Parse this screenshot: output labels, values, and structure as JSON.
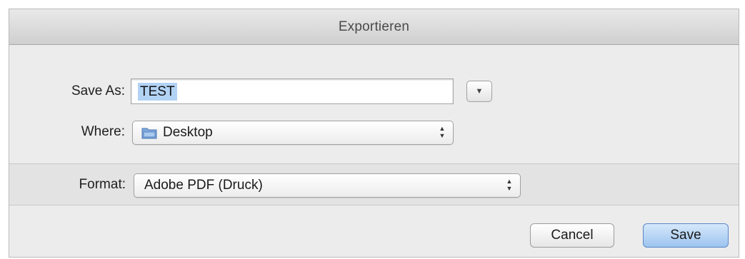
{
  "window": {
    "title": "Exportieren"
  },
  "save_as": {
    "label": "Save As:",
    "value": "TEST",
    "disclosure_icon": "triangle-down-icon"
  },
  "where": {
    "label": "Where:",
    "value": "Desktop",
    "icon": "folder-icon"
  },
  "format": {
    "label": "Format:",
    "value": "Adobe PDF (Druck)"
  },
  "buttons": {
    "cancel": "Cancel",
    "save": "Save"
  },
  "colors": {
    "selection": "#b3d3f5",
    "default_button": "#9cc4ef",
    "folder_icon": "#5d8fc9"
  }
}
